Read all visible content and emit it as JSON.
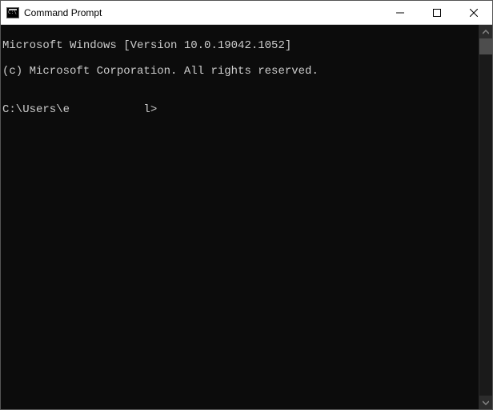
{
  "window": {
    "title": "Command Prompt"
  },
  "console": {
    "line1": "Microsoft Windows [Version 10.0.19042.1052]",
    "line2": "(c) Microsoft Corporation. All rights reserved.",
    "blank": "",
    "prompt": "C:\\Users\\e           l>"
  }
}
